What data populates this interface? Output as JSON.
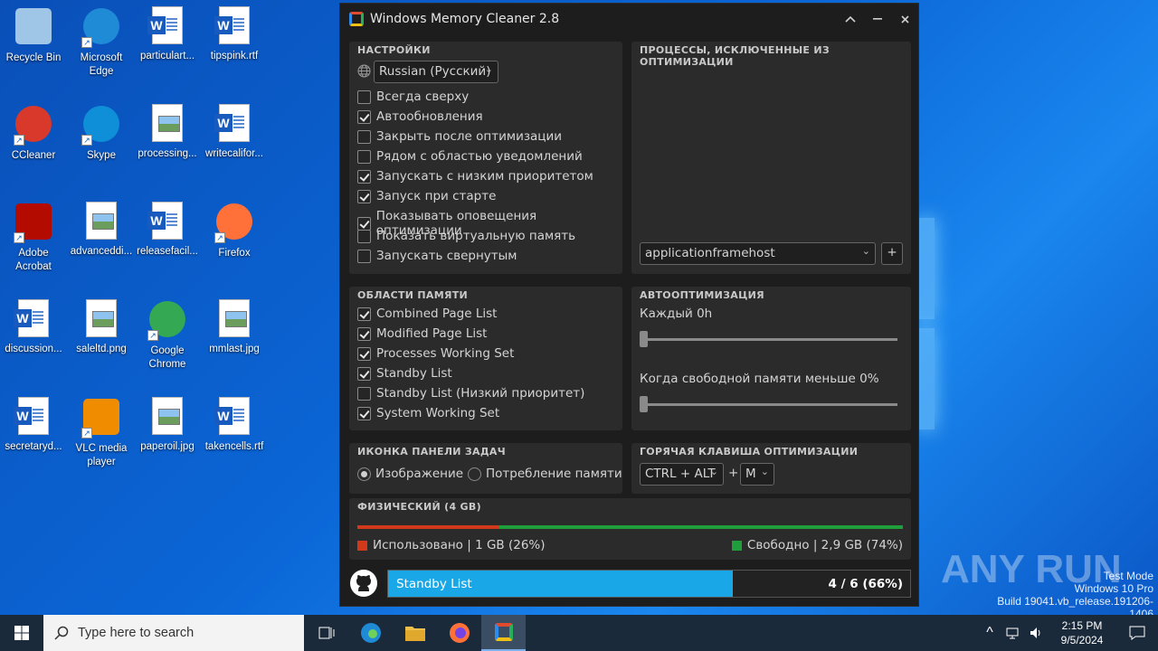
{
  "desktop": {
    "icons": [
      {
        "label": "Recycle Bin",
        "icon": "recycle-bin-icon"
      },
      {
        "label": "Microsoft Edge",
        "icon": "edge-icon"
      },
      {
        "label": "particulart...",
        "icon": "word-doc-icon"
      },
      {
        "label": "tipspink.rtf",
        "icon": "word-doc-icon"
      },
      {
        "label": "CCleaner",
        "icon": "ccleaner-icon"
      },
      {
        "label": "Skype",
        "icon": "skype-icon"
      },
      {
        "label": "processing...",
        "icon": "image-file-icon"
      },
      {
        "label": "writecalifor...",
        "icon": "word-doc-icon"
      },
      {
        "label": "Adobe Acrobat",
        "icon": "acrobat-icon"
      },
      {
        "label": "advanceddi...",
        "icon": "image-file-icon"
      },
      {
        "label": "releasefacil...",
        "icon": "word-doc-icon"
      },
      {
        "label": "Firefox",
        "icon": "firefox-icon"
      },
      {
        "label": "discussion...",
        "icon": "word-doc-icon"
      },
      {
        "label": "saleltd.png",
        "icon": "image-file-icon"
      },
      {
        "label": "Google Chrome",
        "icon": "chrome-icon"
      },
      {
        "label": "mmlast.jpg",
        "icon": "image-file-icon"
      },
      {
        "label": "secretaryd...",
        "icon": "word-doc-icon"
      },
      {
        "label": "VLC media player",
        "icon": "vlc-icon"
      },
      {
        "label": "paperoil.jpg",
        "icon": "image-file-icon"
      },
      {
        "label": "takencells.rtf",
        "icon": "word-doc-icon"
      }
    ],
    "watermark": {
      "brand": "ANY RUN",
      "line1": "Test Mode",
      "line2": "Windows 10 Pro",
      "line3": "Build 19041.vb_release.191206-1406"
    }
  },
  "window": {
    "title": "Windows Memory Cleaner 2.8",
    "settings": {
      "heading": "НАСТРОЙКИ",
      "language": "Russian (Русский)",
      "options": [
        {
          "label": "Всегда сверху",
          "checked": false
        },
        {
          "label": "Автообновления",
          "checked": true
        },
        {
          "label": "Закрыть после оптимизации",
          "checked": false
        },
        {
          "label": "Рядом с областью уведомлений",
          "checked": false
        },
        {
          "label": "Запускать с низким приоритетом",
          "checked": true
        },
        {
          "label": "Запуск при старте",
          "checked": true
        },
        {
          "label": "Показывать оповещения оптимизации",
          "checked": true
        },
        {
          "label": "Показать виртуальную память",
          "checked": false
        },
        {
          "label": "Запускать свернутым",
          "checked": false
        }
      ]
    },
    "excluded": {
      "heading": "ПРОЦЕССЫ, ИСКЛЮЧЕННЫЕ ИЗ ОПТИМИЗАЦИИ",
      "process_select": "applicationframehost",
      "add_label": "+"
    },
    "memory_areas": {
      "heading": "ОБЛАСТИ ПАМЯТИ",
      "options": [
        {
          "label": "Combined Page List",
          "checked": true
        },
        {
          "label": "Modified Page List",
          "checked": true
        },
        {
          "label": "Processes Working Set",
          "checked": true
        },
        {
          "label": "Standby List",
          "checked": true
        },
        {
          "label": "Standby List (Низкий приоритет)",
          "checked": false
        },
        {
          "label": "System Working Set",
          "checked": true
        }
      ]
    },
    "auto": {
      "heading": "АВТООПТИМИЗАЦИЯ",
      "every_label": "Каждый 0h",
      "every_value": 0,
      "free_label": "Когда свободной памяти меньше 0%",
      "free_value": 0
    },
    "tray_icon": {
      "heading": "ИКОНКА ПАНЕЛИ ЗАДАЧ",
      "option_image": "Изображение",
      "option_usage": "Потребление памяти",
      "selected": "image"
    },
    "hotkey": {
      "heading": "ГОРЯЧАЯ КЛАВИША ОПТИМИЗАЦИИ",
      "modifier": "CTRL + ALT",
      "plus": "+",
      "key": "M"
    },
    "physical": {
      "heading": "ФИЗИЧЕСКИЙ (4 GB)",
      "used_fraction": 0.26,
      "used_text": "Использовано | 1 GB (26%)",
      "free_text": "Свободно | 2,9 GB (74%)",
      "used_color": "#d03a1b",
      "free_color": "#1f9e3b"
    },
    "progress": {
      "label": "Standby List",
      "counter": "4 / 6 (66%)",
      "fraction": 0.66,
      "color": "#1aa7e8"
    }
  },
  "taskbar": {
    "search_placeholder": "Type here to search",
    "time": "2:15 PM",
    "date": "9/5/2024"
  }
}
